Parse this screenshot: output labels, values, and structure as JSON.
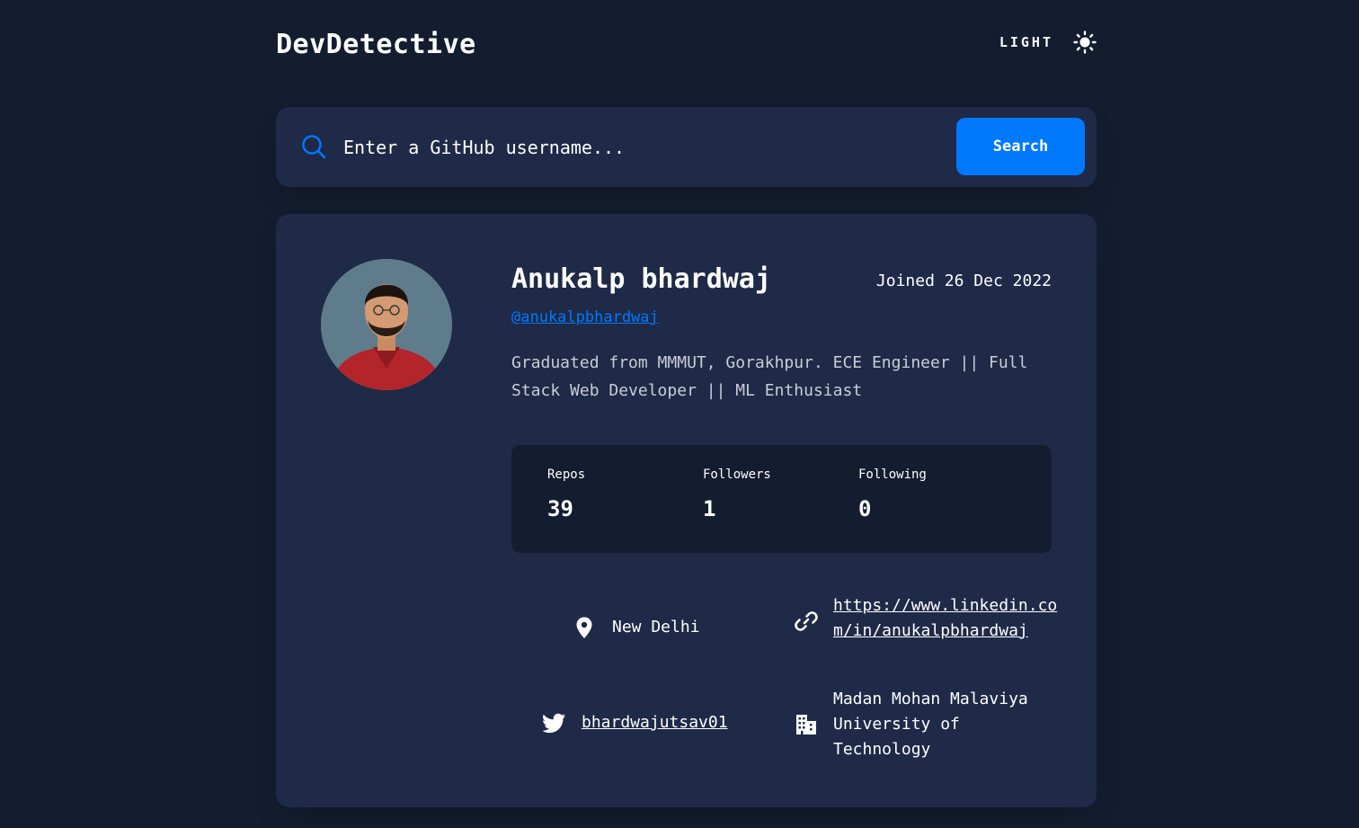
{
  "header": {
    "app_title": "DevDetective",
    "theme_label": "LIGHT",
    "theme_icon": "sun-icon"
  },
  "search": {
    "placeholder": "Enter a GitHub username...",
    "button_label": "Search",
    "icon": "search-icon"
  },
  "profile": {
    "name": "Anukalp bhardwaj",
    "joined": "Joined 26 Dec 2022",
    "login": "@anukalpbhardwaj",
    "bio": "Graduated from MMMUT, Gorakhpur. ECE Engineer || Full Stack Web Developer || ML Enthusiast",
    "stats": {
      "repos_label": "Repos",
      "repos_value": "39",
      "followers_label": "Followers",
      "followers_value": "1",
      "following_label": "Following",
      "following_value": "0"
    },
    "info": {
      "location": "New Delhi",
      "blog": "https://www.linkedin.com/in/anukalpbhardwaj",
      "twitter": "bhardwajutsav01",
      "company": "Madan Mohan Malaviya University of Technology"
    }
  },
  "colors": {
    "background": "#141d2f",
    "card": "#1e2a47",
    "accent": "#0079ff",
    "text": "#ffffff"
  }
}
